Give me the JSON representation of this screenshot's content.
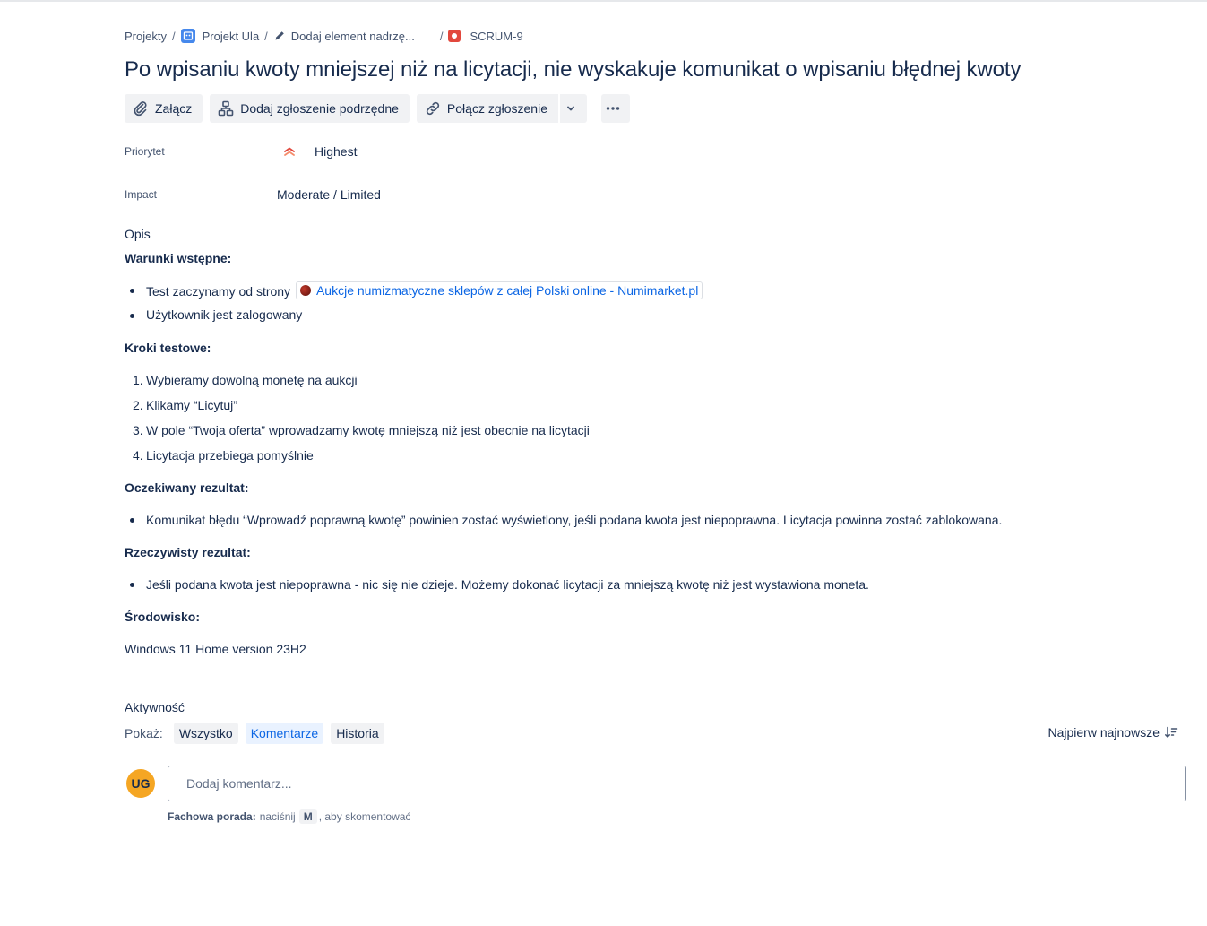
{
  "breadcrumb": {
    "projects": "Projekty",
    "sep": "/",
    "project": "Projekt Ula",
    "parent": "Dodaj element nadrzę...",
    "issue_key": "SCRUM-9"
  },
  "issue": {
    "title": "Po wpisaniu kwoty mniejszej niż na licytacji, nie wyskakuje komunikat o wpisaniu błędnej kwoty"
  },
  "toolbar": {
    "attach": "Załącz",
    "add_child": "Dodaj zgłoszenie podrzędne",
    "link_issue": "Połącz zgłoszenie"
  },
  "fields": {
    "priority_label": "Priorytet",
    "priority_value": "Highest",
    "impact_label": "Impact",
    "impact_value": "Moderate / Limited"
  },
  "description": {
    "heading": "Opis",
    "preconditions_title": "Warunki wstępne:",
    "pre_item1_text": "Test zaczynamy od strony",
    "pre_item1_link": "Aukcje numizmatyczne sklepów z całej Polski online - Numimarket.pl",
    "pre_item2": "Użytkownik jest zalogowany",
    "steps_title": "Kroki testowe:",
    "steps": [
      "Wybieramy dowolną monetę na aukcji",
      "Klikamy “Licytuj”",
      "W pole “Twoja oferta” wprowadzamy kwotę mniejszą niż jest obecnie na licytacji",
      "Licytacja przebiega pomyślnie"
    ],
    "step_numbers": [
      "1.",
      "2.",
      "3.",
      "4."
    ],
    "expected_title": "Oczekiwany rezultat:",
    "expected_item": "Komunikat błędu “Wprowadź poprawną kwotę” powinien zostać wyświetlony, jeśli podana kwota jest niepoprawna. Licytacja powinna zostać zablokowana.",
    "actual_title": "Rzeczywisty rezultat:",
    "actual_item": "Jeśli podana kwota jest niepoprawna - nic się nie dzieje. Możemy dokonać licytacji za mniejszą kwotę niż jest wystawiona moneta.",
    "env_title": "Środowisko:",
    "env_value": "Windows 11 Home version 23H2"
  },
  "activity": {
    "title": "Aktywność",
    "show_label": "Pokaż:",
    "filters": [
      "Wszystko",
      "Komentarze",
      "Historia"
    ],
    "active_filter": "Komentarze",
    "sort_label": "Najpierw najnowsze",
    "avatar_initials": "UG",
    "comment_placeholder": "Dodaj komentarz...",
    "tip_bold": "Fachowa porada:",
    "tip_pre": "naciśnij",
    "tip_key": "M",
    "tip_post": ", aby skomentować"
  },
  "colors": {
    "accent": "#0c66e4",
    "priority_highest": "#e2483d",
    "avatar_bg": "#f5a623",
    "issue_type_bug": "#e2483d",
    "project_icon": "#4688ec"
  },
  "icons": {
    "project": "project-board-icon",
    "parent": "pencil-icon",
    "issue_type": "bug-icon",
    "attach": "paperclip-icon",
    "child": "hierarchy-icon",
    "link": "link-icon",
    "dropdown": "chevron-down-icon",
    "more": "more-horizontal-icon",
    "priority": "priority-highest-icon",
    "sort": "sort-descending-icon"
  }
}
